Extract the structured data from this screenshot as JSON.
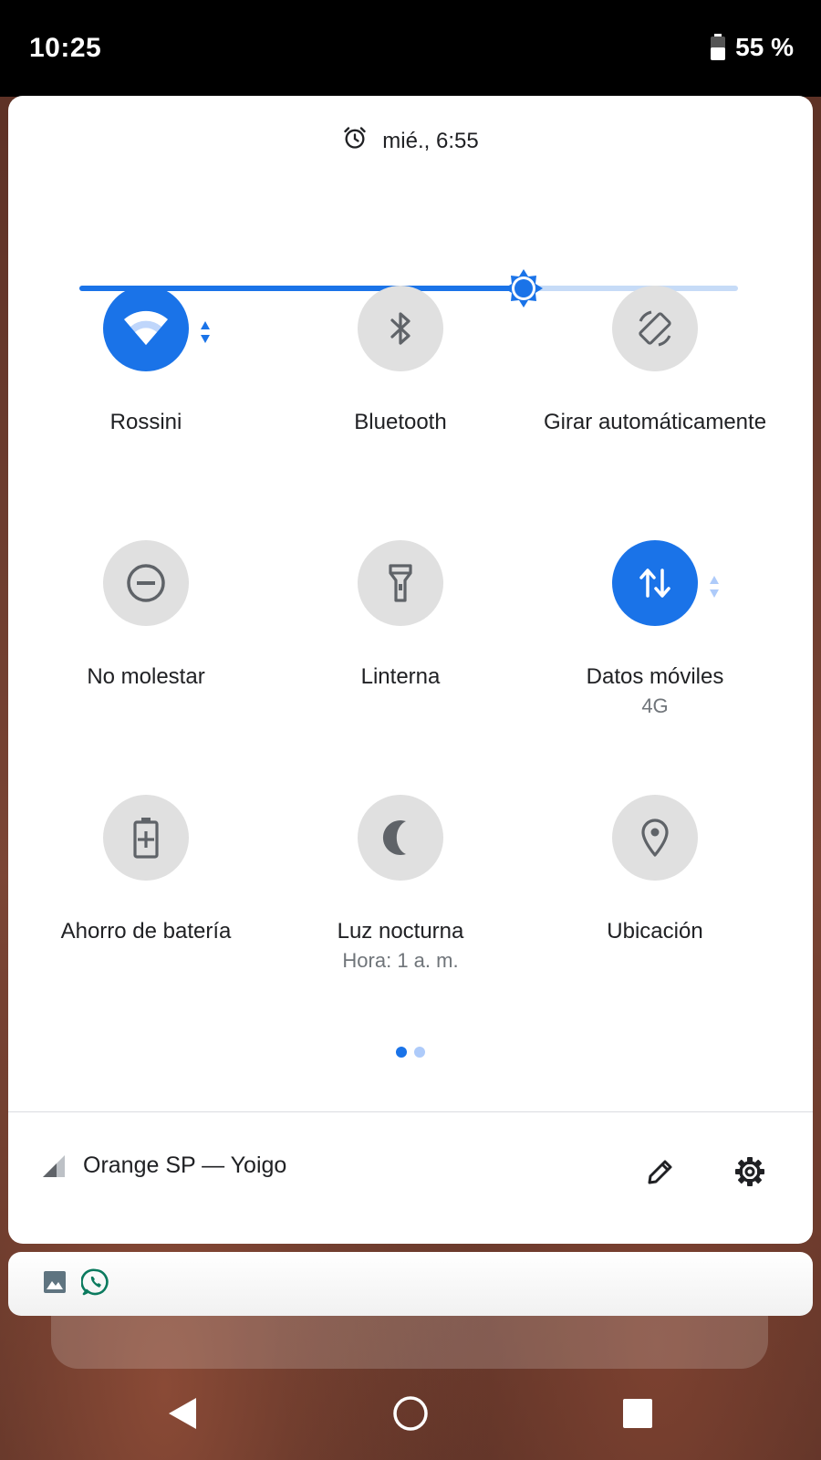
{
  "status_bar": {
    "time": "10:25",
    "battery_percent": "55 %",
    "battery_level": 0.55
  },
  "quick_settings": {
    "alarm_text": "mié., 6:55",
    "brightness_level": 0.675,
    "accent_color": "#1a73e8",
    "tiles": [
      {
        "label": "Rossini",
        "icon": "wifi-icon",
        "active": true
      },
      {
        "label": "Bluetooth",
        "icon": "bluetooth-icon",
        "active": false
      },
      {
        "label": "Girar automáticamente",
        "icon": "auto-rotate-icon",
        "active": false
      },
      {
        "label": "No molestar",
        "icon": "do-not-disturb-icon",
        "active": false
      },
      {
        "label": "Linterna",
        "icon": "flashlight-icon",
        "active": false
      },
      {
        "label": "Datos móviles",
        "sublabel": "4G",
        "icon": "mobile-data-icon",
        "active": true
      },
      {
        "label": "Ahorro de batería",
        "icon": "battery-saver-icon",
        "active": false
      },
      {
        "label": "Luz nocturna",
        "sublabel": "Hora: 1 a. m.",
        "icon": "night-light-icon",
        "active": false
      },
      {
        "label": "Ubicación",
        "icon": "location-icon",
        "active": false
      }
    ],
    "pages": {
      "count": 2,
      "current": 1
    },
    "footer": {
      "carrier": "Orange SP — Yoigo",
      "edit_icon": "pencil-icon",
      "settings_icon": "gear-icon"
    }
  },
  "notification_icons": [
    "image-icon",
    "whatsapp-icon"
  ],
  "navigation": {
    "back_icon": "back-triangle-icon",
    "home_icon": "home-circle-icon",
    "recents_icon": "recents-square-icon"
  }
}
